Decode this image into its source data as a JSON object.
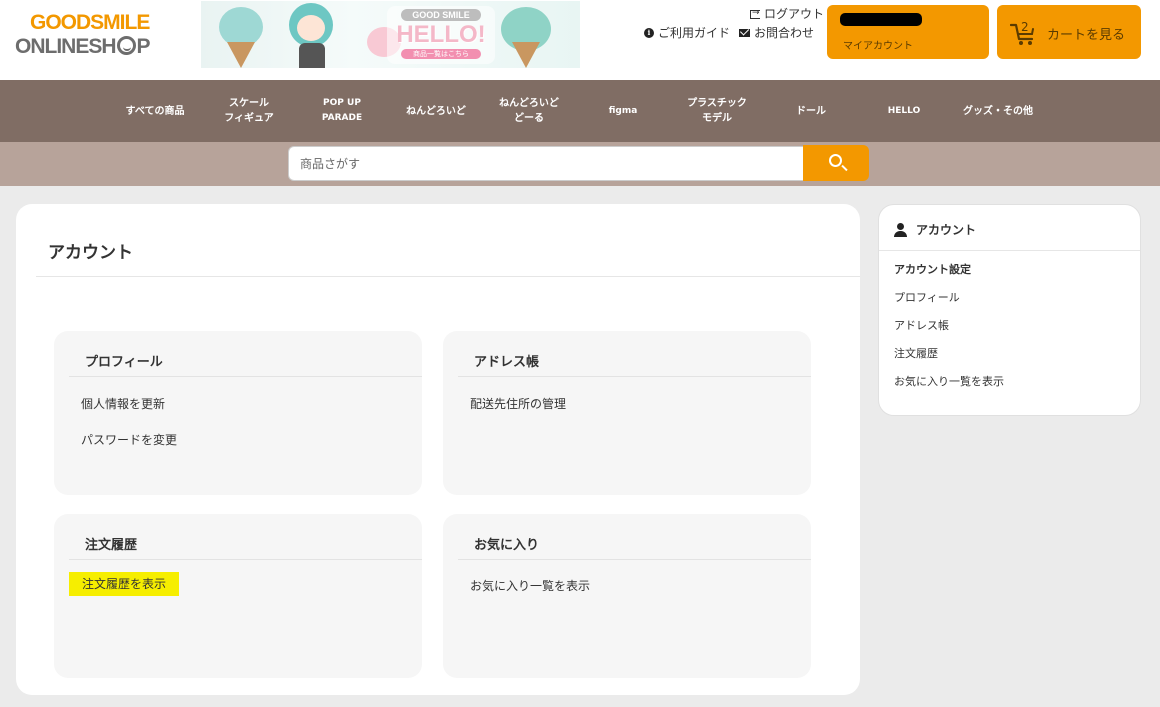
{
  "header": {
    "logo": {
      "good": "GOOD",
      "smile": "SMILE",
      "online": "ONLINE",
      "shop_sh": "SH",
      "shop_p": "P"
    },
    "banner": {
      "brand": "GOOD SMILE",
      "headline": "HELLO!",
      "sub": "商品一覧はこちら"
    },
    "logout_label": "ログアウト",
    "guide_label": "ご利用ガイド",
    "contact_label": "お問合わせ",
    "account": {
      "label": "マイアカウント"
    },
    "cart": {
      "count": "2",
      "label": "カートを見る"
    }
  },
  "nav": {
    "items": [
      {
        "label": "すべての商品"
      },
      {
        "label": "スケール\nフィギュア"
      },
      {
        "label": "POP UP\nPARADE"
      },
      {
        "label": "ねんどろいど"
      },
      {
        "label": "ねんどろいど\nどーる"
      },
      {
        "label": "figma"
      },
      {
        "label": "プラスチック\nモデル"
      },
      {
        "label": "ドール"
      },
      {
        "label": "HELLO"
      },
      {
        "label": "グッズ・その他"
      }
    ]
  },
  "search": {
    "placeholder": "商品さがす",
    "value": ""
  },
  "main": {
    "title": "アカウント",
    "boxes": {
      "profile": {
        "heading": "プロフィール",
        "links": [
          "個人情報を更新",
          "パスワードを変更"
        ]
      },
      "address": {
        "heading": "アドレス帳",
        "links": [
          "配送先住所の管理"
        ]
      },
      "orders": {
        "heading": "注文履歴",
        "links": [
          "注文履歴を表示"
        ]
      },
      "favorites": {
        "heading": "お気に入り",
        "links": [
          "お気に入り一覧を表示"
        ]
      }
    }
  },
  "sidebar": {
    "heading": "アカウント",
    "section": "アカウント設定",
    "links": [
      "プロフィール",
      "アドレス帳",
      "注文履歴",
      "お気に入り一覧を表示"
    ]
  },
  "colors": {
    "accent": "#f39800",
    "nav_bg": "#806d64",
    "search_bg": "#b7a39a",
    "highlight": "#f6ee00",
    "page_bg": "#ebebeb"
  }
}
